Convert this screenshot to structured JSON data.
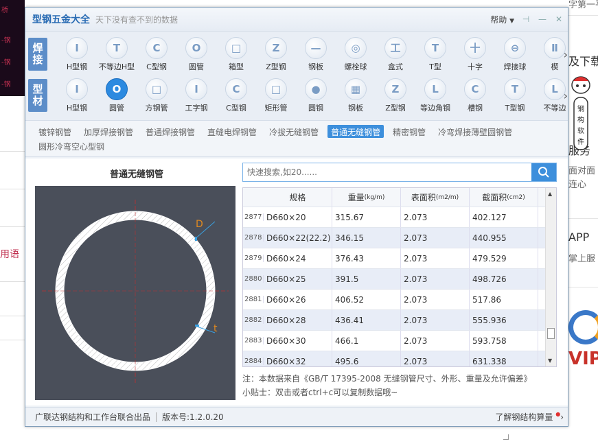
{
  "background": {
    "left_texts": [
      "桥",
      "-钢",
      "-钢",
      "-钢"
    ],
    "left_red": "用语",
    "right_texts": [
      "字第一平台",
      "及下载",
      "服务",
      "面对面",
      "连心",
      "APP",
      "掌上服",
      "VIP"
    ],
    "right_sub": [
      "...",
      "..."
    ],
    "mascot_text": "钢构软件"
  },
  "window": {
    "title": "型钢五金大全",
    "subtitle": "天下没有查不到的数据",
    "help_label": "帮助",
    "pin": "⊣",
    "minimize": "—",
    "close": "✕"
  },
  "weld_row": {
    "label": "焊接",
    "items": [
      {
        "label": "H型钢",
        "glyph": "I"
      },
      {
        "label": "不等边H型",
        "glyph": "T"
      },
      {
        "label": "C型钢",
        "glyph": "C"
      },
      {
        "label": "圆管",
        "glyph": "O"
      },
      {
        "label": "箱型",
        "glyph": "□"
      },
      {
        "label": "Z型钢",
        "glyph": "Z"
      },
      {
        "label": "钢板",
        "glyph": "—"
      },
      {
        "label": "螺栓球",
        "glyph": "◎"
      },
      {
        "label": "盒式",
        "glyph": "工"
      },
      {
        "label": "T型",
        "glyph": "T"
      },
      {
        "label": "十字",
        "glyph": "十"
      },
      {
        "label": "焊接球",
        "glyph": "⊖"
      },
      {
        "label": "楔",
        "glyph": "Ⅱ"
      }
    ]
  },
  "material_row": {
    "label": "型材",
    "items": [
      {
        "label": "H型钢",
        "glyph": "I"
      },
      {
        "label": "圆管",
        "glyph": "O"
      },
      {
        "label": "方钢管",
        "glyph": "□"
      },
      {
        "label": "工字钢",
        "glyph": "I"
      },
      {
        "label": "C型钢",
        "glyph": "C"
      },
      {
        "label": "矩形管",
        "glyph": "□"
      },
      {
        "label": "圆钢",
        "glyph": "●"
      },
      {
        "label": "钢板",
        "glyph": "▦"
      },
      {
        "label": "Z型钢",
        "glyph": "Z"
      },
      {
        "label": "等边角钢",
        "glyph": "L"
      },
      {
        "label": "槽钢",
        "glyph": "C"
      },
      {
        "label": "T型钢",
        "glyph": "T"
      },
      {
        "label": "不等边",
        "glyph": "L"
      }
    ],
    "selected_index": 1
  },
  "subtabs": [
    "镀锌钢管",
    "加厚焊接钢管",
    "普通焊接钢管",
    "直缝电焊钢管",
    "冷拔无缝钢管",
    "普通无缝钢管",
    "精密钢管",
    "冷弯焊接薄壁圆钢管",
    "圆形冷弯空心型钢"
  ],
  "subtab_active_index": 5,
  "diagram": {
    "title": "普通无缝钢管",
    "label_d": "D",
    "label_t": "t"
  },
  "search": {
    "placeholder": "快速搜索,如20......"
  },
  "table": {
    "headers": {
      "spec": "规格",
      "weight": "重量",
      "weight_unit": "(kg/m)",
      "surface": "表面积",
      "surface_unit": "(m2/m)",
      "section": "截面积",
      "section_unit": "(cm2)"
    },
    "rows": [
      {
        "id": "2877",
        "spec": "D660×20",
        "weight": "315.67",
        "surface": "2.073",
        "section": "402.127"
      },
      {
        "id": "2878",
        "spec": "D660×22(22.2)",
        "weight": "346.15",
        "surface": "2.073",
        "section": "440.955"
      },
      {
        "id": "2879",
        "spec": "D660×24",
        "weight": "376.43",
        "surface": "2.073",
        "section": "479.529"
      },
      {
        "id": "2880",
        "spec": "D660×25",
        "weight": "391.5",
        "surface": "2.073",
        "section": "498.726"
      },
      {
        "id": "2881",
        "spec": "D660×26",
        "weight": "406.52",
        "surface": "2.073",
        "section": "517.86"
      },
      {
        "id": "2882",
        "spec": "D660×28",
        "weight": "436.41",
        "surface": "2.073",
        "section": "555.936"
      },
      {
        "id": "2883",
        "spec": "D660×30",
        "weight": "466.1",
        "surface": "2.073",
        "section": "593.758"
      },
      {
        "id": "2884",
        "spec": "D660×32",
        "weight": "495.6",
        "surface": "2.073",
        "section": "631.338"
      }
    ]
  },
  "notes": {
    "source": "注：本数据来自《GB/T  17395-2008  无缝钢管尺寸、外形、重量及允许偏差》",
    "tip": "小贴士：双击或者ctrl+c可以复制数据哦~"
  },
  "footer": {
    "publisher": "广联达钢结构和工作台联合出品",
    "version": "版本号:1.2.0.20",
    "learn": "了解钢结构算量"
  },
  "colors": {
    "accent": "#3d8fdc",
    "title_blue": "#2a6cb4",
    "row_label": "#5c8dc8",
    "diagram_bg": "#4a4f5a",
    "dim_orange": "#e08a20"
  }
}
